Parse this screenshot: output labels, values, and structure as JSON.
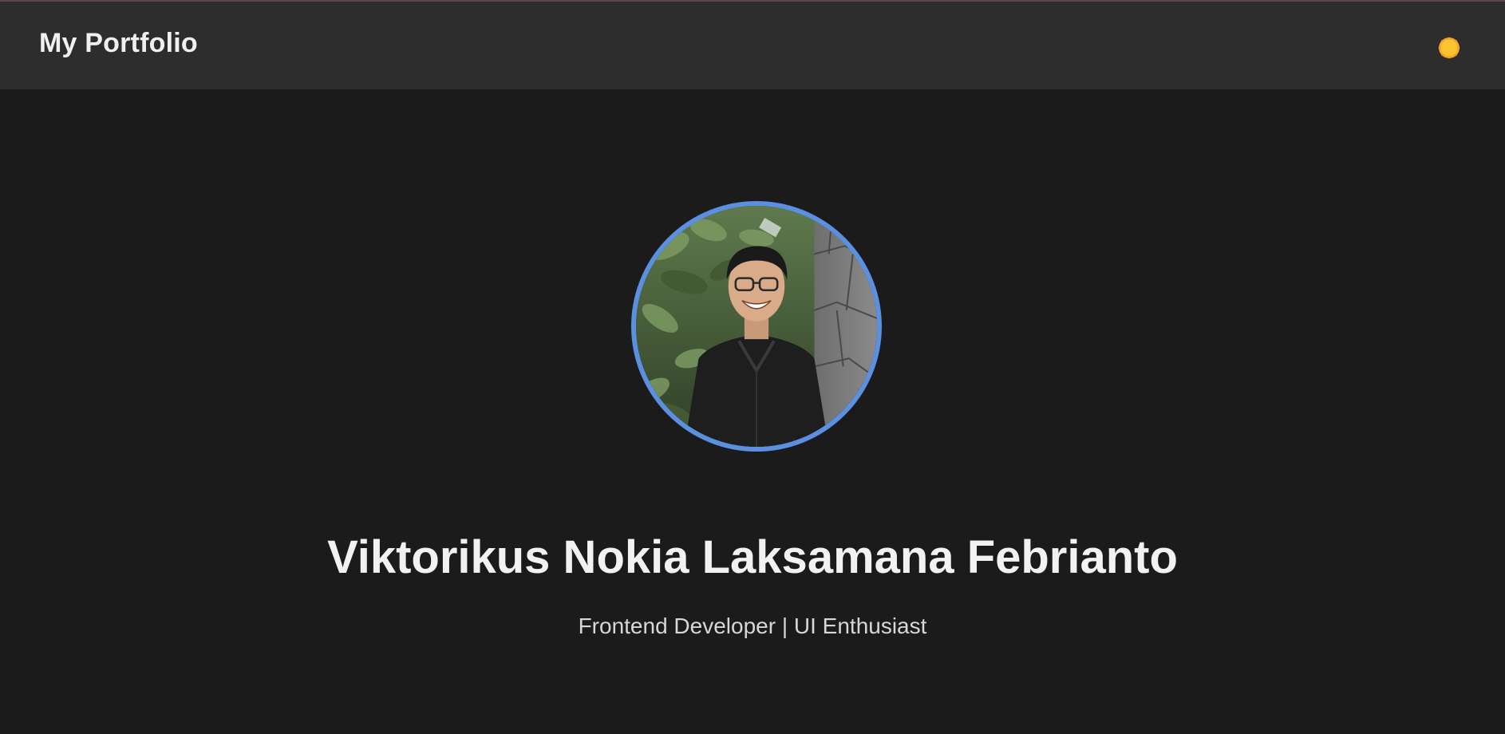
{
  "navbar": {
    "brand": "My Portfolio",
    "theme_toggle_icon": "sun-icon"
  },
  "hero": {
    "avatar_icon": "profile-photo",
    "name": "Viktorikus Nokia Laksamana Febrianto",
    "tagline": "Frontend Developer | UI Enthusiast"
  },
  "colors": {
    "background": "#1b1b1b",
    "navbar": "#2d2d2d",
    "avatar_border": "#5b8fe0",
    "sun": "#f6b21b"
  }
}
